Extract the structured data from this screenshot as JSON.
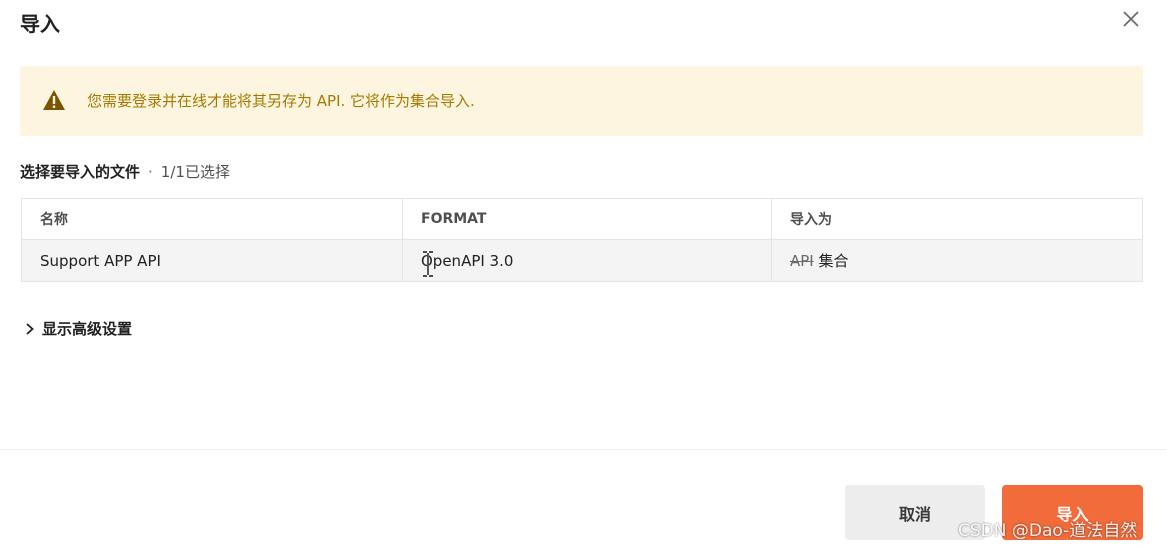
{
  "dialog": {
    "title": "导入",
    "close_icon": "close-icon"
  },
  "warning": {
    "icon": "warning-triangle-icon",
    "text": "您需要登录并在线才能将其另存为 API. 它将作为集合导入.",
    "bg_color": "#fdf5df",
    "text_color": "#a57900"
  },
  "files": {
    "label": "选择要导入的文件",
    "separator": "·",
    "count": "1/1已选择",
    "columns": [
      "名称",
      "FORMAT",
      "导入为"
    ],
    "rows": [
      {
        "name": "Support APP API",
        "format": "OpenAPI 3.0",
        "import_as_struck": "API",
        "import_as": "集合"
      }
    ]
  },
  "advanced": {
    "icon": "chevron-right-icon",
    "label": "显示高级设置"
  },
  "footer": {
    "cancel_label": "取消",
    "import_label": "导入",
    "accent_color": "#f26b3a"
  },
  "watermark": "CSDN @Dao-道法自然"
}
